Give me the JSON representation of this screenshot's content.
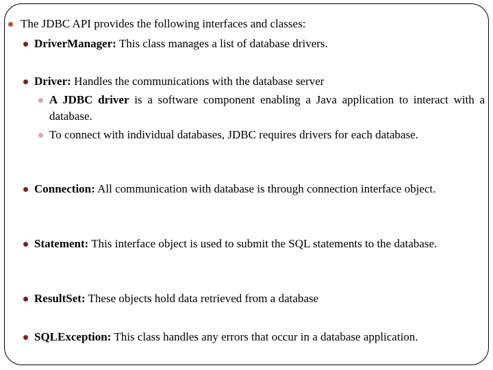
{
  "slide": {
    "intro": "The JDBC API provides the following interfaces and classes:",
    "items": [
      {
        "term": "DriverManager:",
        "text": " This class manages a list of database drivers."
      },
      {
        "term": "Driver:",
        "text": " Handles the communications with the database server",
        "sub": [
          {
            "term": "A JDBC  driver",
            "text": " is  a software component  enabling  a Java application  to interact with a database."
          },
          {
            "term": "",
            "text": "To connect with individual databases, JDBC requires drivers for each database."
          }
        ]
      },
      {
        "term": "Connection:",
        "text": "  All communication with database is through connection interface object."
      },
      {
        "term": "Statement:",
        "text": " This interface object is used to submit the SQL statements to the database."
      },
      {
        "term": "ResultSet:",
        "text": " These objects hold data retrieved from a database"
      },
      {
        "term": "SQLException:",
        "text": " This class handles any errors that occur in a database application."
      }
    ]
  },
  "colors": {
    "bullet_l1": "#c8522a",
    "bullet_l2": "#7d1f1a",
    "bullet_l3": "#d8a8a4"
  }
}
